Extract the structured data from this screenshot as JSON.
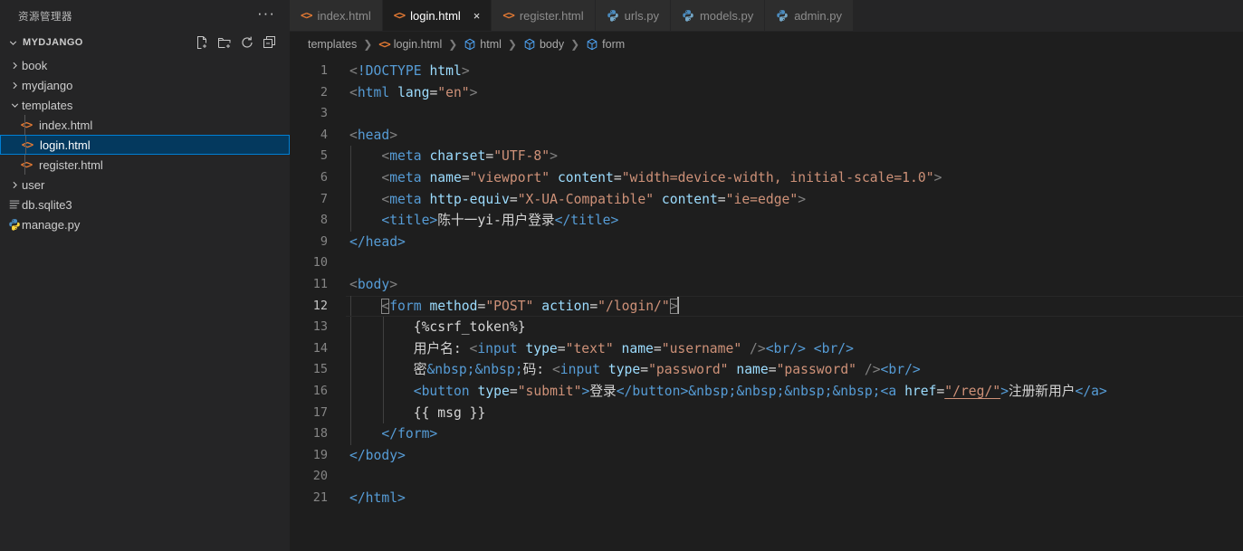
{
  "sidebar": {
    "title": "资源管理器",
    "more_label": "···",
    "project": "MYDJANGO",
    "actions": [
      {
        "name": "new-file-icon",
        "label": "New File"
      },
      {
        "name": "new-folder-icon",
        "label": "New Folder"
      },
      {
        "name": "refresh-icon",
        "label": "Refresh Explorer"
      },
      {
        "name": "collapse-all-icon",
        "label": "Collapse Folders in Explorer"
      }
    ],
    "tree": [
      {
        "label": "book",
        "type": "folder",
        "expanded": false,
        "depth": 1
      },
      {
        "label": "mydjango",
        "type": "folder",
        "expanded": false,
        "depth": 1
      },
      {
        "label": "templates",
        "type": "folder",
        "expanded": true,
        "depth": 1
      },
      {
        "label": "index.html",
        "type": "html",
        "depth": 2
      },
      {
        "label": "login.html",
        "type": "html",
        "depth": 2,
        "selected": true
      },
      {
        "label": "register.html",
        "type": "html",
        "depth": 2
      },
      {
        "label": "user",
        "type": "folder",
        "expanded": false,
        "depth": 1
      },
      {
        "label": "db.sqlite3",
        "type": "db",
        "depth": 1
      },
      {
        "label": "manage.py",
        "type": "python",
        "depth": 1
      }
    ]
  },
  "tabs": [
    {
      "label": "index.html",
      "icon": "html-icon",
      "active": false,
      "closable": false
    },
    {
      "label": "login.html",
      "icon": "html-icon",
      "active": true,
      "closable": true,
      "close_label": "×"
    },
    {
      "label": "register.html",
      "icon": "html-icon",
      "active": false,
      "closable": false
    },
    {
      "label": "urls.py",
      "icon": "python-icon",
      "active": false,
      "closable": false
    },
    {
      "label": "models.py",
      "icon": "python-icon",
      "active": false,
      "closable": false
    },
    {
      "label": "admin.py",
      "icon": "python-icon",
      "active": false,
      "closable": false
    }
  ],
  "breadcrumb": [
    {
      "label": "templates",
      "icon": "none"
    },
    {
      "label": "login.html",
      "icon": "html-icon"
    },
    {
      "label": "html",
      "icon": "symbol-field-icon"
    },
    {
      "label": "body",
      "icon": "symbol-field-icon"
    },
    {
      "label": "form",
      "icon": "symbol-field-icon"
    }
  ],
  "editor": {
    "active_line": 12,
    "line_numbers": [
      "1",
      "2",
      "3",
      "4",
      "5",
      "6",
      "7",
      "8",
      "9",
      "10",
      "11",
      "12",
      "13",
      "14",
      "15",
      "16",
      "17",
      "18",
      "19",
      "20",
      "21"
    ],
    "lines": {
      "1": "<!DOCTYPE html>",
      "2": "<html lang=\"en\">",
      "3": "",
      "4": "<head>",
      "5": "    <meta charset=\"UTF-8\">",
      "6": "    <meta name=\"viewport\" content=\"width=device-width, initial-scale=1.0\">",
      "7": "    <meta http-equiv=\"X-UA-Compatible\" content=\"ie=edge\">",
      "8": "    <title>陈十一yi-用户登录</title>",
      "9": "</head>",
      "10": "",
      "11": "<body>",
      "12": "    <form method=\"POST\" action=\"/login/\">",
      "13": "        {%csrf_token%}",
      "14": "        用户名: <input type=\"text\" name=\"username\" /><br/> <br/>",
      "15": "        密&nbsp;&nbsp;码: <input type=\"password\" name=\"password\" /><br/>",
      "16": "        <button type=\"submit\">登录</button>&nbsp;&nbsp;&nbsp;&nbsp;<a href=\"/reg/\">注册新用户</a>",
      "17": "        {{ msg }}",
      "18": "    </form>",
      "19": "</body>",
      "20": "",
      "21": "</html>"
    },
    "tokens": {
      "l1": {
        "lt": "<",
        "doctype": "!DOCTYPE",
        "name": "html",
        "gt": ">"
      },
      "l2": {
        "lt": "<",
        "tag": "html",
        "attr": "lang",
        "eq": "=",
        "val": "\"en\"",
        "gt": ">"
      },
      "l4": {
        "lt": "<",
        "tag": "head",
        "gt": ">"
      },
      "l5": {
        "lt": "<",
        "tag": "meta",
        "attr": "charset",
        "eq": "=",
        "val": "\"UTF-8\"",
        "gt": ">"
      },
      "l6": {
        "lt": "<",
        "tag": "meta",
        "attr1": "name",
        "val1": "\"viewport\"",
        "attr2": "content",
        "val2": "\"width=device-width, initial-scale=1.0\"",
        "gt": ">"
      },
      "l7": {
        "lt": "<",
        "tag": "meta",
        "attr1": "http-equiv",
        "val1": "\"X-UA-Compatible\"",
        "attr2": "content",
        "val2": "\"ie=edge\"",
        "gt": ">"
      },
      "l8": {
        "open": "<title>",
        "text": "陈十一yi-用户登录",
        "close": "</title>"
      },
      "l9": {
        "close": "</head>"
      },
      "l11": {
        "lt": "<",
        "tag": "body",
        "gt": ">"
      },
      "l12": {
        "lt": "<",
        "tag": "form",
        "attr1": "method",
        "val1": "\"POST\"",
        "attr2": "action",
        "val2": "\"/login/\"",
        "gt": ">"
      },
      "l13": {
        "text": "{%csrf_token%}"
      },
      "l14": {
        "label": "用户名: ",
        "lt": "<",
        "tag": "input",
        "attr1": "type",
        "val1": "\"text\"",
        "attr2": "name",
        "val2": "\"username\"",
        "selfclose": " />",
        "br1": "<br/>",
        "br2": "<br/>"
      },
      "l15": {
        "label_a": "密",
        "ent1": "&nbsp;",
        "ent2": "&nbsp;",
        "label_b": "码: ",
        "lt": "<",
        "tag": "input",
        "attr1": "type",
        "val1": "\"password\"",
        "attr2": "name",
        "val2": "\"password\"",
        "selfclose": " />",
        "br1": "<br/>"
      },
      "l16": {
        "btn_open": "<button ",
        "attr1": "type",
        "val1": "\"submit\"",
        "btn_gt": ">",
        "btn_text": "登录",
        "btn_close": "</button>",
        "ents": "&nbsp;&nbsp;&nbsp;&nbsp;",
        "a_open": "<a ",
        "attr2": "href",
        "val2": "\"/reg/\"",
        "a_gt": ">",
        "a_text": "注册新用户",
        "a_close": "</a>"
      },
      "l17": {
        "text": "{{ msg }}"
      },
      "l18": {
        "close": "</form>"
      },
      "l19": {
        "close": "</body>"
      },
      "l21": {
        "close": "</html>"
      }
    }
  },
  "colors": {
    "editor_bg": "#1e1e1e",
    "sidebar_bg": "#252526",
    "tab_inactive_bg": "#2d2d2d",
    "selection_blue": "#04395e",
    "selection_border": "#007fd4",
    "html_icon": "#e37933",
    "python_icon": "#519aba",
    "tag": "#569cd6",
    "attr": "#9cdcfe",
    "string": "#ce9178",
    "text": "#d4d4d4",
    "gutter": "#858585"
  }
}
